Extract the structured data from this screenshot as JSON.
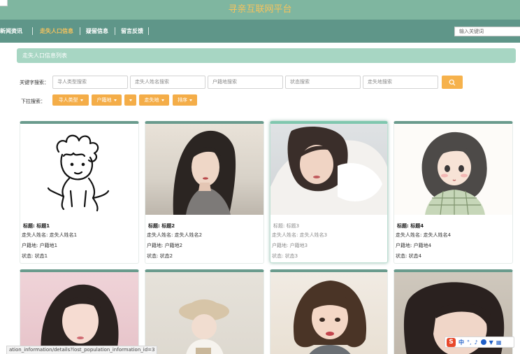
{
  "header": {
    "title": "寻亲互联网平台"
  },
  "nav": {
    "items": [
      {
        "label": "新闻资讯",
        "active": false
      },
      {
        "label": "走失人口信息",
        "active": true
      },
      {
        "label": "疑留信息",
        "active": false
      },
      {
        "label": "留言反馈",
        "active": false
      }
    ],
    "search_placeholder": "输入关键词"
  },
  "list": {
    "title": "走失人口信息列表",
    "keyword_label": "关键字搜索：",
    "dropdown_label": "下拉搜索：",
    "keyword_inputs": [
      "寻人类型搜索",
      "走失人姓名搜索",
      "户籍地搜索",
      "状态搜索",
      "走失地搜索"
    ],
    "search_icon": "search-icon",
    "dropdowns": [
      "寻人类型",
      "户籍地",
      "",
      "走失地",
      "排序"
    ]
  },
  "cards": [
    {
      "title": "标题: 标题1",
      "name": "走失人姓名: 走失人姓名1",
      "origin": "户籍地: 户籍地1",
      "status": "状态: 状态1",
      "image": "line-drawing-boy"
    },
    {
      "title": "标题: 标题2",
      "name": "走失人姓名: 走失人姓名2",
      "origin": "户籍地: 户籍地2",
      "status": "状态: 状态2",
      "image": "photo-girl-dark-hair"
    },
    {
      "title": "标题: 标题3",
      "name": "走失人姓名: 走失人姓名3",
      "origin": "户籍地: 户籍地3",
      "status": "状态: 状态3",
      "image": "photo-girl-pillow"
    },
    {
      "title": "标题: 标题4",
      "name": "走失人姓名: 走失人姓名4",
      "origin": "户籍地: 户籍地4",
      "status": "状态: 状态4",
      "image": "anime-girl-plaid"
    },
    {
      "image": "photo-girl-pink"
    },
    {
      "image": "photo-child-hat"
    },
    {
      "image": "painting-girl-bob"
    },
    {
      "image": "photo-girl-side"
    }
  ],
  "status_bar": {
    "url": "ation_information/details?lost_population_information_id=3"
  },
  "ime": {
    "label": "中"
  }
}
